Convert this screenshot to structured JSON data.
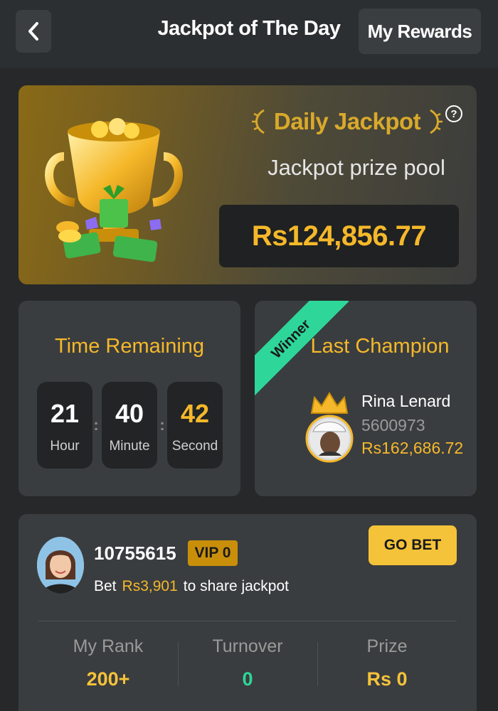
{
  "header": {
    "title": "Jackpot of The Day",
    "rewards_label": "My Rewards"
  },
  "jackpot": {
    "title": "Daily Jackpot",
    "pool_label": "Jackpot prize pool",
    "pool_amount": "Rs124,856.77"
  },
  "timer": {
    "title": "Time Remaining",
    "units": [
      {
        "value": "21",
        "label": "Hour",
        "color": "#ffffff"
      },
      {
        "value": "40",
        "label": "Minute",
        "color": "#ffffff"
      },
      {
        "value": "42",
        "label": "Second",
        "color": "#f5b82a"
      }
    ],
    "separator": ":"
  },
  "champion": {
    "ribbon": "Winner",
    "title": "Last Champion",
    "name": "Rina Lenard",
    "id": "5600973",
    "amount": "Rs162,686.72"
  },
  "user": {
    "id": "10755615",
    "vip": "VIP 0",
    "bet_prefix": "Bet",
    "bet_amount": "Rs3,901",
    "bet_suffix": "to share jackpot",
    "go_bet_label": "GO BET",
    "stats": [
      {
        "label": "My Rank",
        "value": "200+",
        "color": "#f5c33a"
      },
      {
        "label": "Turnover",
        "value": "0",
        "color": "#2ed69a"
      },
      {
        "label": "Prize",
        "value": "Rs 0",
        "color": "#f5c33a"
      }
    ]
  },
  "colors": {
    "accent_gold": "#f5b82a",
    "accent_green": "#2ed69a",
    "background": "#262829",
    "card": "#3a3d3f"
  },
  "icons": [
    "back-chevron-icon",
    "help-icon",
    "trophy-icon",
    "laurel-icon",
    "crown-icon"
  ]
}
